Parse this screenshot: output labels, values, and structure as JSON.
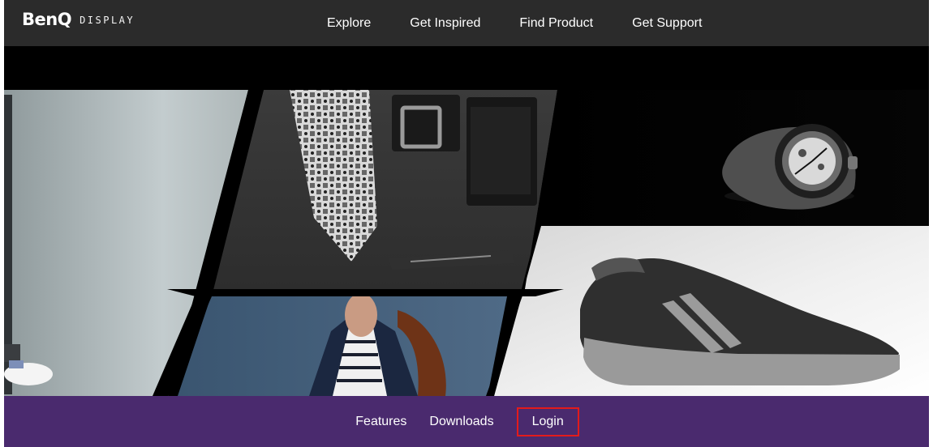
{
  "brand": {
    "logo": "BenQ",
    "subtitle": "DISPLAY"
  },
  "top_nav": [
    {
      "label": "Explore"
    },
    {
      "label": "Get Inspired"
    },
    {
      "label": "Find Product"
    },
    {
      "label": "Get Support"
    }
  ],
  "hero": {
    "images": [
      {
        "name": "person-walking-image"
      },
      {
        "name": "tie-belt-wallet-image"
      },
      {
        "name": "watch-image"
      },
      {
        "name": "man-with-bag-image"
      },
      {
        "name": "shoe-image"
      }
    ]
  },
  "bottom_nav": [
    {
      "label": "Features"
    },
    {
      "label": "Downloads"
    },
    {
      "label": "Login"
    }
  ],
  "colors": {
    "top_bar": "#2b2b2b",
    "bottom_bar": "#4a2a6e",
    "highlight": "#e31b1b"
  }
}
